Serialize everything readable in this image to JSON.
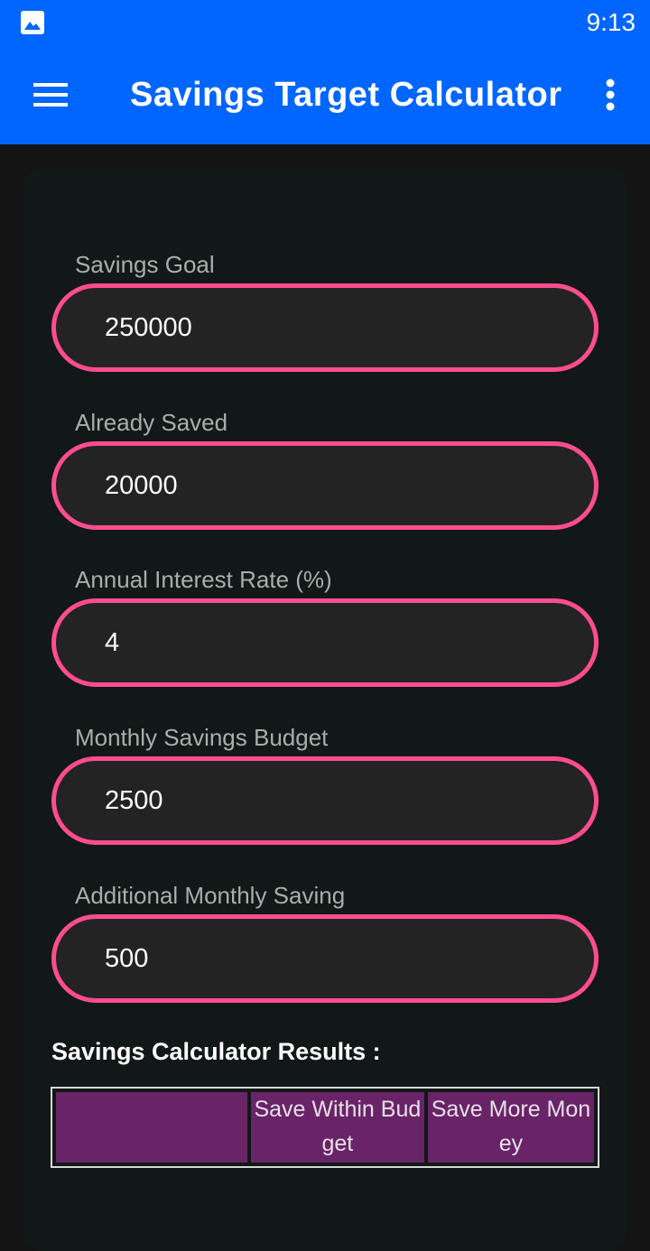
{
  "status_bar": {
    "time": "9:13",
    "icons": [
      "gallery-icon"
    ]
  },
  "app_bar": {
    "title": "Savings Target Calculator",
    "icons": [
      "hamburger-menu-icon",
      "more-vert-icon"
    ]
  },
  "form": {
    "savings_goal": {
      "label": "Savings Goal",
      "value": "250000"
    },
    "already_saved": {
      "label": "Already Saved",
      "value": "20000"
    },
    "interest_rate": {
      "label": "Annual Interest Rate (%)",
      "value": "4"
    },
    "monthly_budget": {
      "label": "Monthly Savings Budget",
      "value": "2500"
    },
    "additional_saving": {
      "label": "Additional Monthly Saving",
      "value": "500"
    }
  },
  "results": {
    "title": "Savings Calculator Results :",
    "headers": [
      "",
      "Save Within Budget",
      "Save More Money"
    ]
  },
  "colors": {
    "app_bar": "#0066ff",
    "accent_border": "#ff4d8f",
    "header_cell": "#692367",
    "card": "#111817",
    "background": "#141414"
  }
}
